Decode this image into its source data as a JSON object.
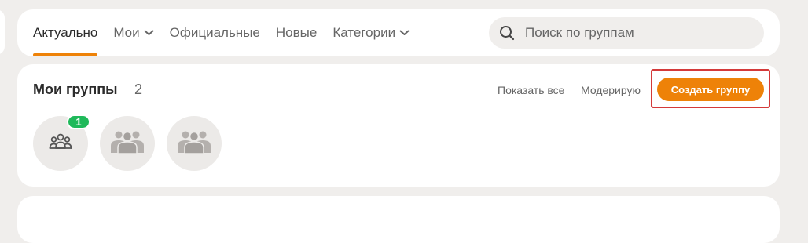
{
  "nav": {
    "tabs": [
      {
        "label": "Актуально",
        "active": true,
        "has_dropdown": false
      },
      {
        "label": "Мои",
        "active": false,
        "has_dropdown": true
      },
      {
        "label": "Официальные",
        "active": false,
        "has_dropdown": false
      },
      {
        "label": "Новые",
        "active": false,
        "has_dropdown": false
      },
      {
        "label": "Категории",
        "active": false,
        "has_dropdown": true
      }
    ],
    "search": {
      "placeholder": "Поиск по группам",
      "value": "",
      "icon": "search-icon"
    }
  },
  "my_groups": {
    "title": "Мои группы",
    "count": "2",
    "show_all_label": "Показать все",
    "moderate_label": "Модерирую",
    "create_button_label": "Создать группу",
    "avatars": [
      {
        "icon": "groups-outline-icon",
        "badge": "1"
      },
      {
        "icon": "group-placeholder-icon",
        "badge": ""
      },
      {
        "icon": "group-placeholder-icon",
        "badge": ""
      }
    ]
  },
  "colors": {
    "accent": "#ee8208",
    "badge": "#1fb95a",
    "page_bg": "#f0eeec",
    "card_bg": "#ffffff",
    "highlight_border": "#d43a3a"
  }
}
